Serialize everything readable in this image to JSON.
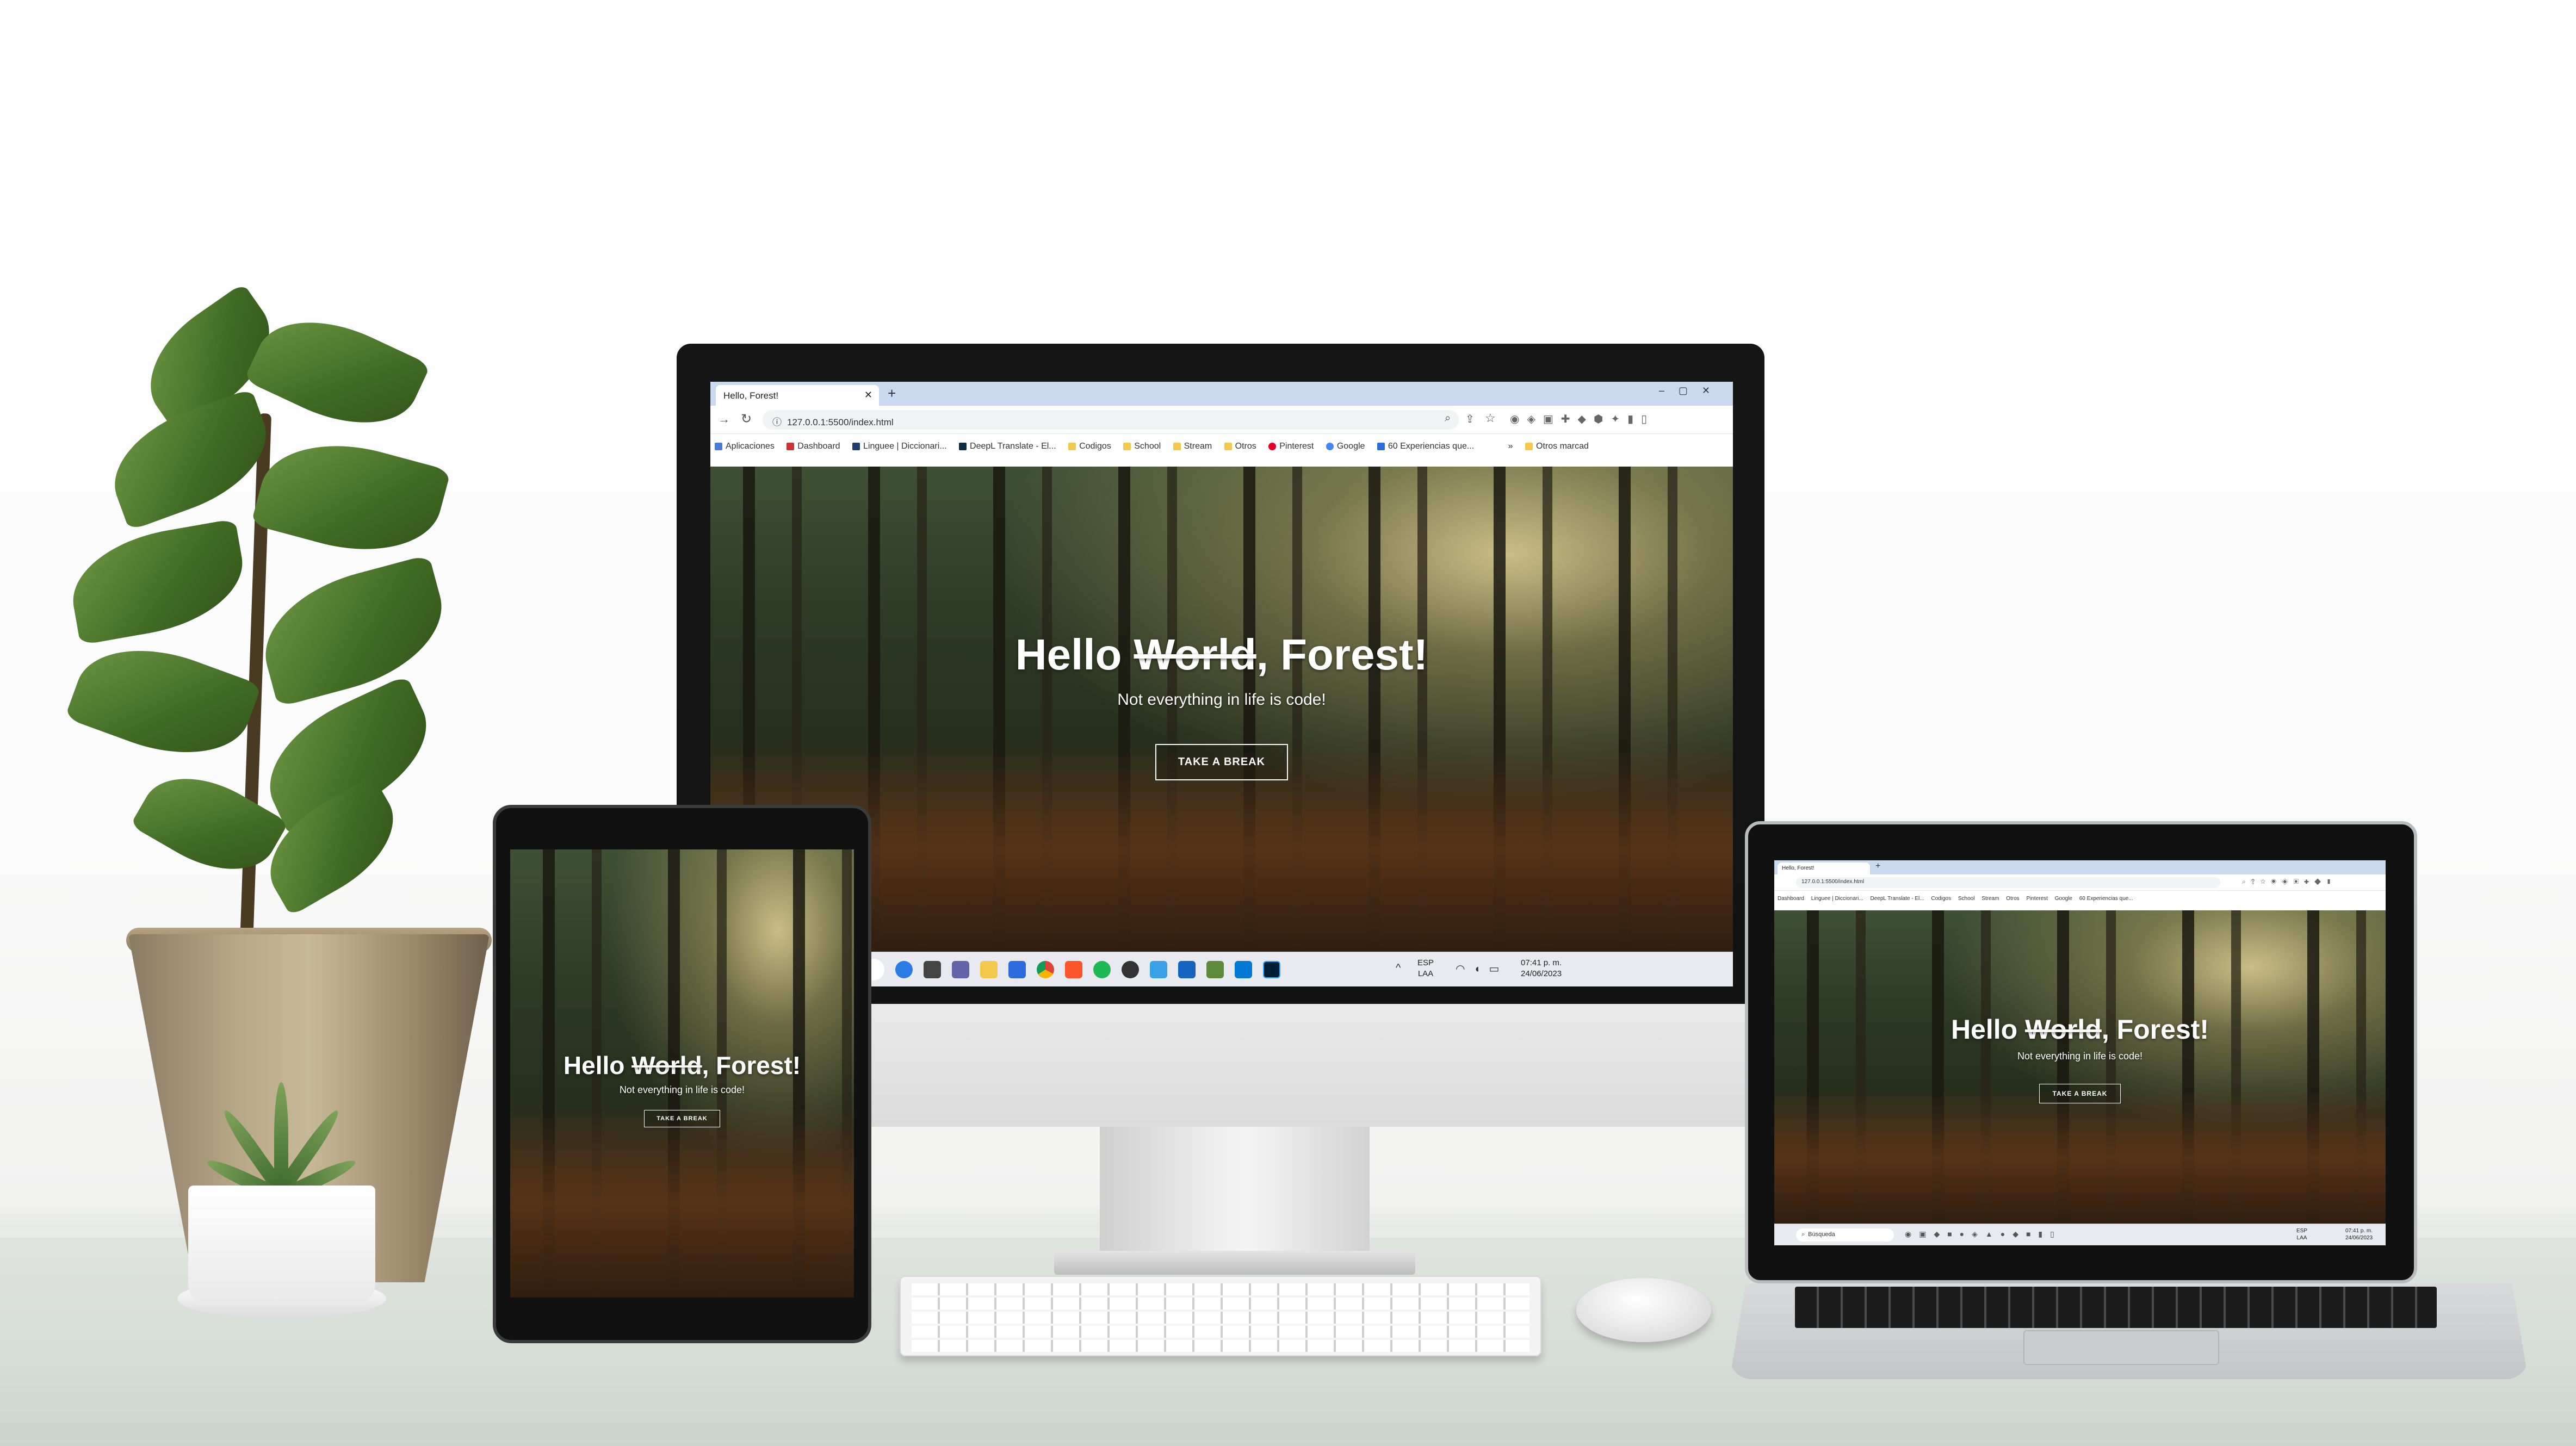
{
  "site": {
    "hello": "Hello ",
    "world": "World",
    "forest": ", Forest!",
    "tagline": "Not everything in life is code!",
    "cta": "TAKE A BREAK"
  },
  "browser": {
    "tab_title": "Hello, Forest!",
    "new_tab": "+",
    "url": "127.0.0.1:5500/index.html",
    "bookmarks": [
      "Aplicaciones",
      "Dashboard",
      "Linguee | Diccionari...",
      "DeepL Translate - El...",
      "Codigos",
      "School",
      "Stream",
      "Otros",
      "Pinterest",
      "Google",
      "60 Experiencias que..."
    ],
    "more_bookmarks": "»",
    "other_bookmarks": "Otros marcad"
  },
  "taskbar": {
    "search": "Búsqueda",
    "lang_1": "ESP",
    "lang_2": "LAA",
    "time": "07:41 p. m.",
    "date": "24/06/2023"
  },
  "colors": {
    "tabbar": "#c9d9f0",
    "accent": "#1a73e8"
  }
}
